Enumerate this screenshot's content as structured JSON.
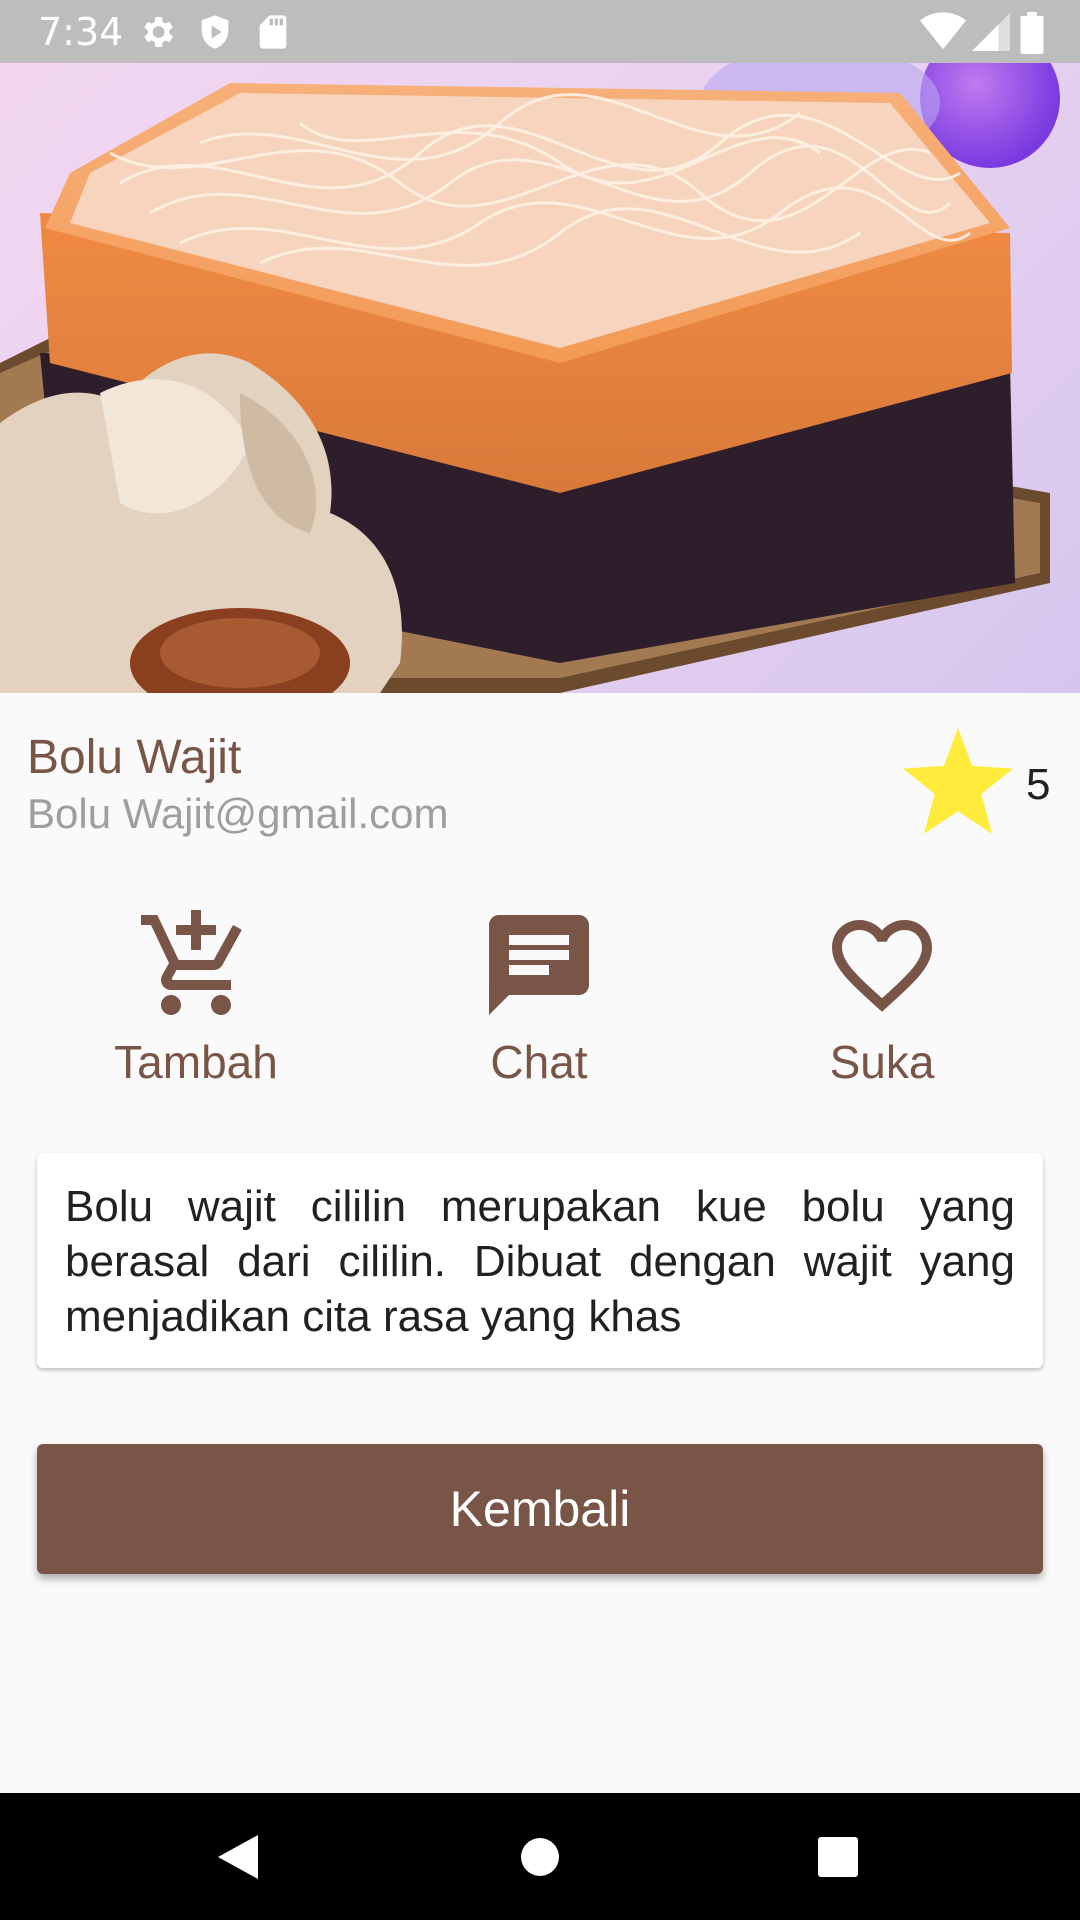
{
  "status_bar": {
    "time": "7:34",
    "icons": [
      "gear-icon",
      "shield-icon",
      "sd-card-icon",
      "wifi-icon",
      "signal-icon",
      "battery-icon"
    ]
  },
  "hero": {
    "image": "bolu-wajit-cake-image"
  },
  "product": {
    "name": "Bolu Wajit",
    "email": "Bolu Wajit@gmail.com",
    "rating": "5"
  },
  "actions": {
    "add_label": "Tambah",
    "chat_label": "Chat",
    "like_label": "Suka"
  },
  "description": "Bolu wajit cililin merupakan kue bolu yang berasal dari cililin. Dibuat dengan wajit yang menjadikan cita rasa yang khas",
  "back_button_label": "Kembali",
  "colors": {
    "primary": "#795548",
    "star": "#ffeb3b",
    "status_bar": "#bdbdbd",
    "nav_bar": "#000000"
  }
}
